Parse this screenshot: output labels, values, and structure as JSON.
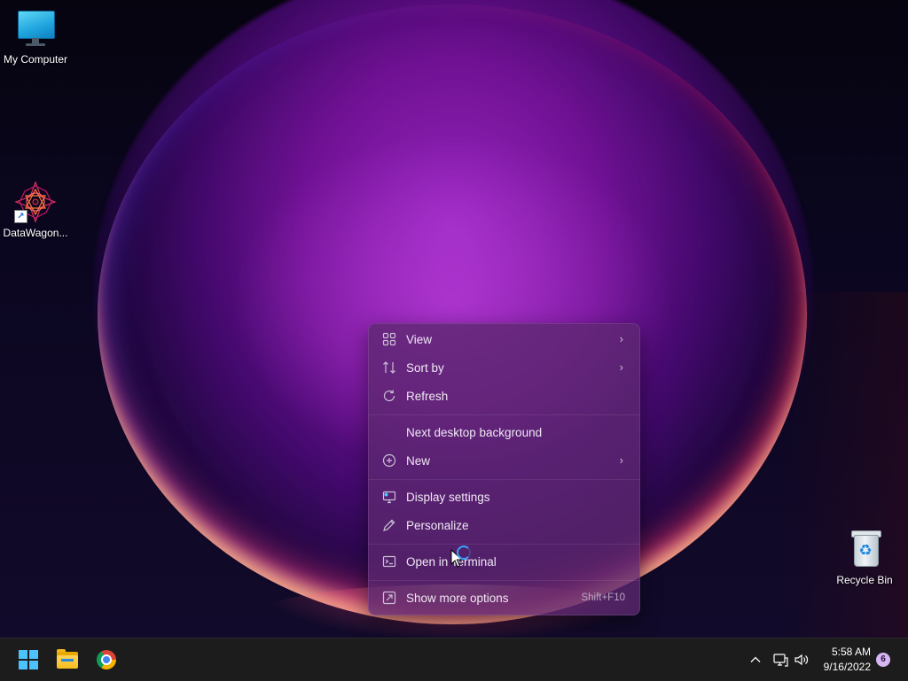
{
  "desktop": {
    "icons": [
      {
        "label": "My Computer",
        "icon": "computer-monitor-icon"
      },
      {
        "label": "DataWagon...",
        "icon": "datawagon-app-icon"
      },
      {
        "label": "Recycle Bin",
        "icon": "recycle-bin-icon"
      }
    ],
    "colors": {
      "accent": "#4cc2ff",
      "menu_bg": "#5c2870",
      "taskbar_bg": "#1c1c1c"
    }
  },
  "context_menu": {
    "items": [
      {
        "label": "View",
        "icon": "grid-view-icon",
        "has_submenu": true
      },
      {
        "label": "Sort by",
        "icon": "sort-icon",
        "has_submenu": true
      },
      {
        "label": "Refresh",
        "icon": "refresh-icon"
      },
      {
        "label": "Next desktop background",
        "icon": ""
      },
      {
        "label": "New",
        "icon": "new-plus-icon",
        "has_submenu": true
      },
      {
        "label": "Display settings",
        "icon": "display-settings-icon"
      },
      {
        "label": "Personalize",
        "icon": "pen-icon"
      },
      {
        "label": "Open in Terminal",
        "icon": "terminal-icon"
      },
      {
        "label": "Show more options",
        "icon": "more-options-icon",
        "shortcut": "Shift+F10"
      }
    ]
  },
  "taskbar": {
    "pinned": [
      {
        "name": "Start",
        "icon": "windows-start-icon"
      },
      {
        "name": "File Explorer",
        "icon": "folder-icon"
      },
      {
        "name": "Google Chrome",
        "icon": "chrome-icon"
      }
    ],
    "tray": {
      "chevron": "^",
      "network_icon": "network-icon",
      "volume_icon": "volume-icon",
      "time": "5:58 AM",
      "date": "9/16/2022",
      "notification_count": "6"
    }
  }
}
